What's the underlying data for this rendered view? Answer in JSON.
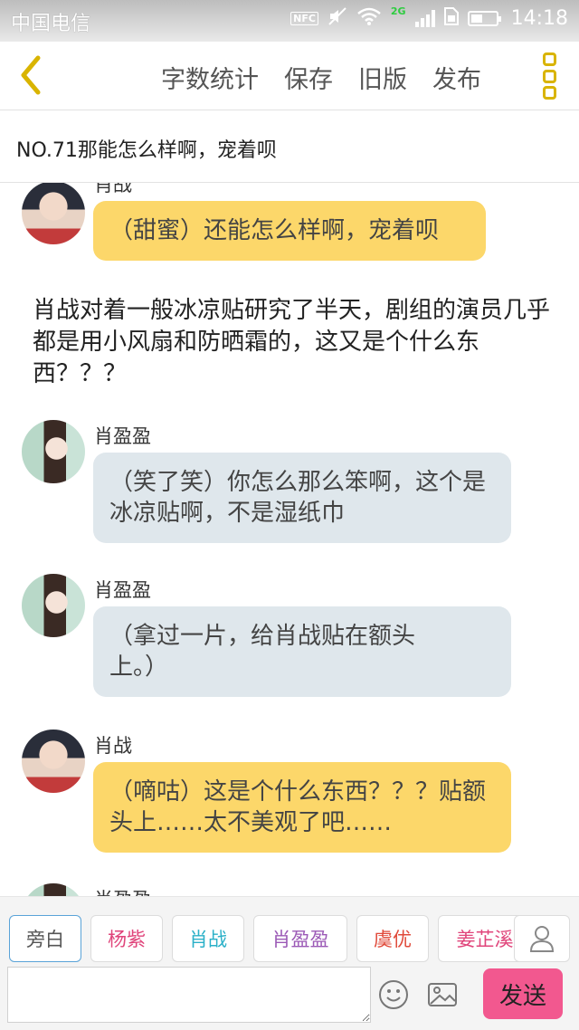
{
  "status_bar": {
    "carrier": "中国电信",
    "nfc": "NFC",
    "network": "2G",
    "time": "14:18",
    "battery_level": 0.45
  },
  "toolbar": {
    "back_icon": "chevron-left-icon",
    "word_count": "字数统计",
    "save": "保存",
    "old_version": "旧版",
    "publish": "发布",
    "menu_icon": "more-vertical-icon",
    "accent_color": "#d9b400"
  },
  "chapter": {
    "title": "NO.71那能怎么样啊，宠着呗"
  },
  "messages": [
    {
      "type": "dialog",
      "speaker": "肖战",
      "avatar": "boy-avatar",
      "color": "yellow",
      "text": "（甜蜜）还能怎么样啊，宠着呗"
    },
    {
      "type": "narration",
      "text": "肖战对着一般冰凉贴研究了半天，剧组的演员几乎都是用小风扇和防晒霜的，这又是个什么东西？？？"
    },
    {
      "type": "dialog",
      "speaker": "肖盈盈",
      "avatar": "girl-avatar",
      "color": "blue",
      "text": "（笑了笑）你怎么那么笨啊，这个是冰凉贴啊，不是湿纸巾"
    },
    {
      "type": "dialog",
      "speaker": "肖盈盈",
      "avatar": "girl-avatar",
      "color": "blue",
      "text": "（拿过一片，给肖战贴在额头上。）"
    },
    {
      "type": "dialog",
      "speaker": "肖战",
      "avatar": "boy-avatar",
      "color": "yellow",
      "text": "（嘀咕）这是个什么东西？？？贴额头上……太不美观了吧……"
    },
    {
      "type": "dialog",
      "speaker": "肖盈盈",
      "avatar": "girl-avatar",
      "color": "blue",
      "text": ""
    }
  ],
  "roles": [
    {
      "label": "旁白",
      "color": "#555555",
      "active": true
    },
    {
      "label": "杨紫",
      "color": "#e0457b",
      "active": false
    },
    {
      "label": "肖战",
      "color": "#2ab0c8",
      "active": false
    },
    {
      "label": "肖盈盈",
      "color": "#9b59b6",
      "active": false
    },
    {
      "label": "虞优",
      "color": "#e04a3a",
      "active": false
    },
    {
      "label": "姜芷溪",
      "color": "#e0457b",
      "active": false
    }
  ],
  "input": {
    "placeholder": "",
    "emoji_icon": "smiley-icon",
    "image_icon": "image-icon",
    "send": "发送",
    "send_color": "#f2588f"
  }
}
